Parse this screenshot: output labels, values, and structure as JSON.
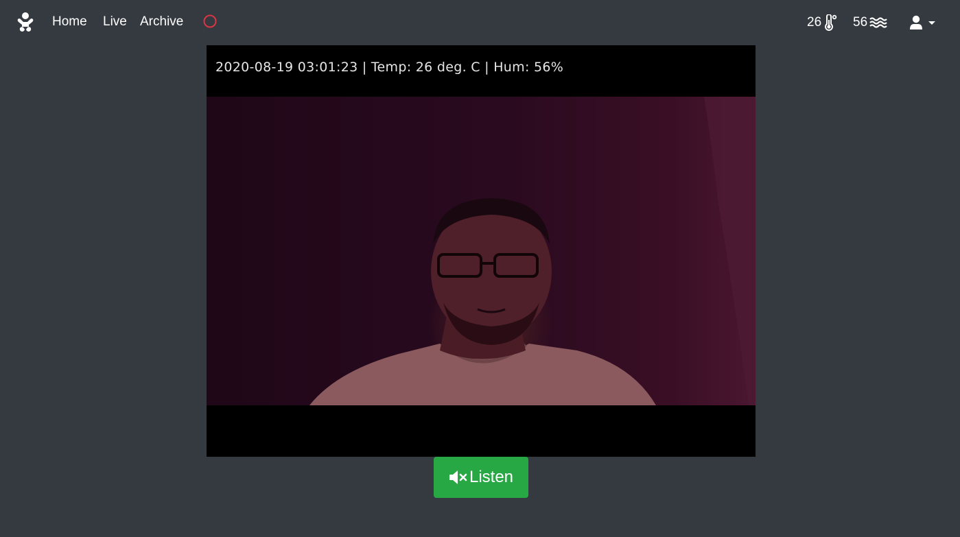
{
  "nav": {
    "brand_icon": "baby-icon",
    "links": [
      {
        "label": "Home"
      },
      {
        "label": "Live"
      },
      {
        "label": "Archive"
      }
    ],
    "record_indicator_color": "#dc3545"
  },
  "sensors": {
    "temperature": {
      "value": "26",
      "icon": "thermometer-icon"
    },
    "humidity": {
      "value": "56",
      "icon": "water-icon"
    }
  },
  "user_menu": {
    "icon": "user-icon"
  },
  "video": {
    "overlay_text": "2020-08-19 03:01:23 | Temp: 26 deg. C  | Hum: 56%"
  },
  "listen_button": {
    "label": "Listen",
    "icon": "volume-mute-icon",
    "color": "#28a745"
  }
}
